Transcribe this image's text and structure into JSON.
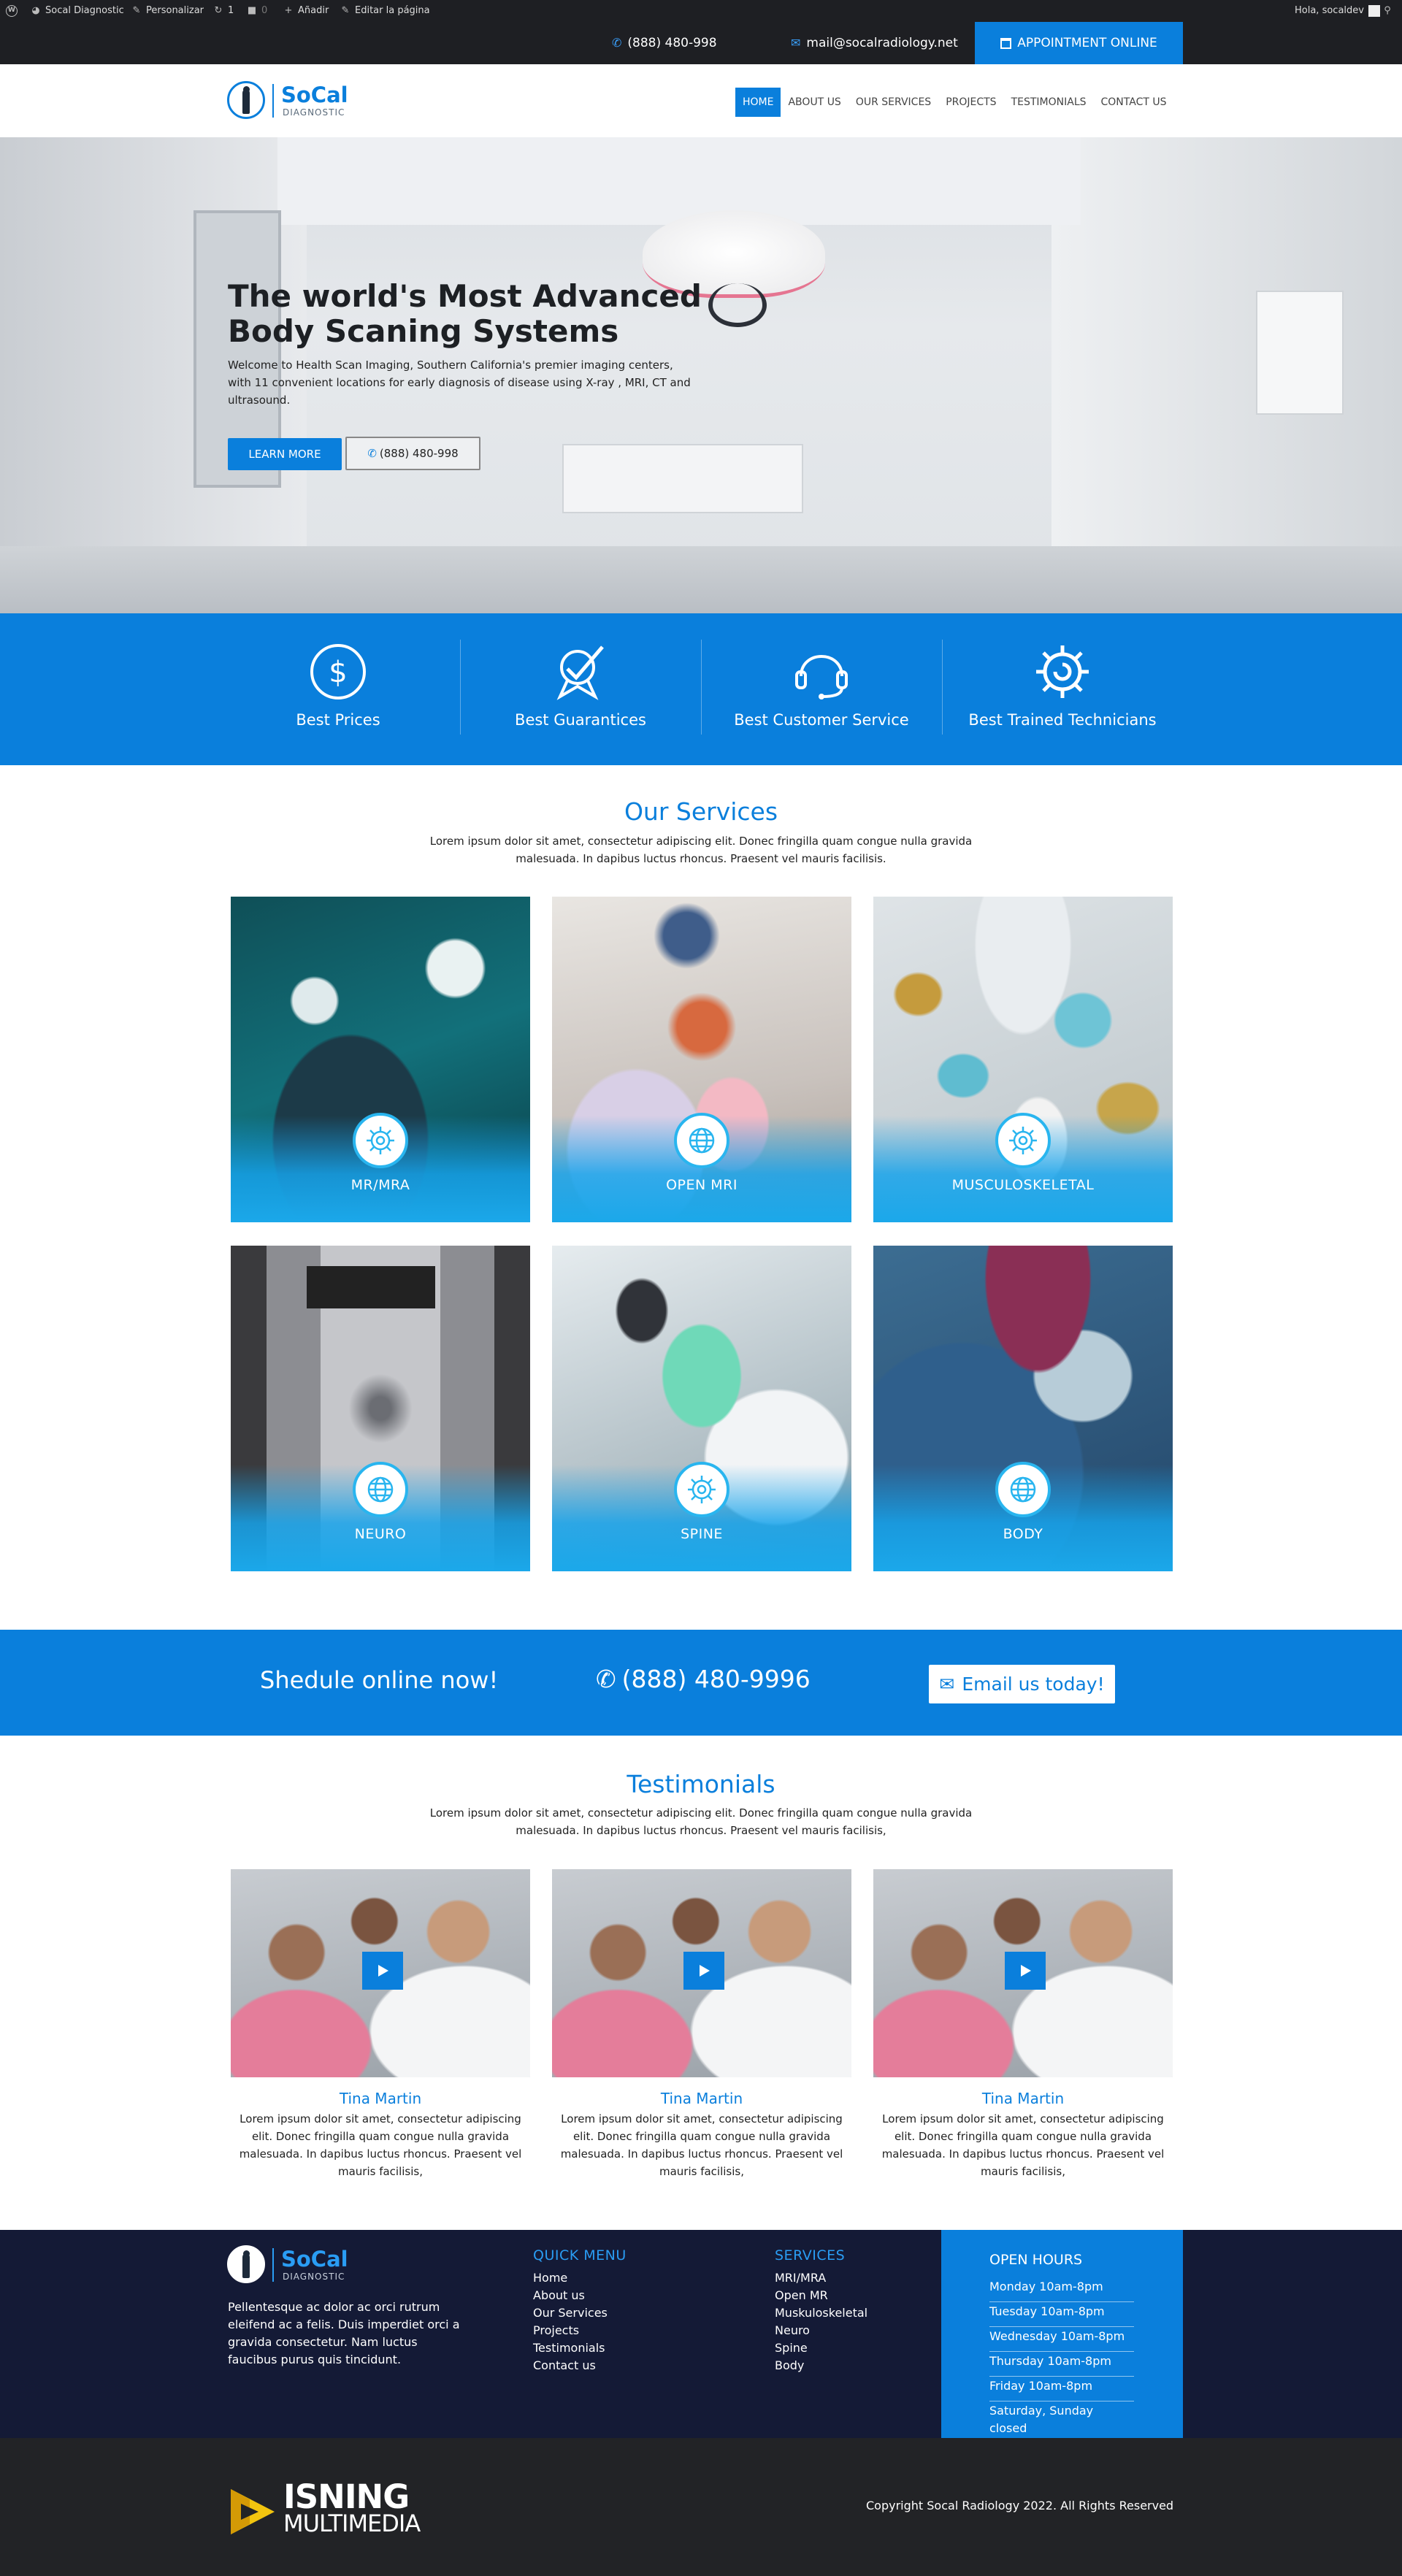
{
  "admin_bar": {
    "site_name": "Socal Diagnostic",
    "customize": "Personalizar",
    "updates": "1",
    "comments": "0",
    "add_new": "Añadir",
    "edit_page": "Editar la página",
    "greeting": "Hola, socaldev"
  },
  "topbar": {
    "phone": "(888) 480-998",
    "email": "mail@socalradiology.net",
    "appointment": "APPOINTMENT ONLINE"
  },
  "logo": {
    "word": "SoCal",
    "sub": "DIAGNOSTIC"
  },
  "nav": [
    {
      "label": "HOME"
    },
    {
      "label": "ABOUT US"
    },
    {
      "label": "OUR SERVICES"
    },
    {
      "label": "PROJECTS"
    },
    {
      "label": "TESTIMONIALS"
    },
    {
      "label": "CONTACT US"
    }
  ],
  "hero": {
    "title": "The world's Most Advanced Body Scaning Systems",
    "text": "Welcome to Health Scan Imaging, Southern California's premier imaging centers, with 11 convenient locations for early diagnosis of disease using X-ray , MRI, CT and ultrasound.",
    "learn_more": "LEARN MORE",
    "phone_button": "(888) 480-998"
  },
  "features": [
    {
      "label": "Best Prices",
      "icon": "dollar-icon"
    },
    {
      "label": "Best Guarantices",
      "icon": "ribbon-check-icon"
    },
    {
      "label": "Best Customer Service",
      "icon": "headset-icon"
    },
    {
      "label": "Best Trained Technicians",
      "icon": "gear-icon"
    }
  ],
  "services": {
    "title": "Our Services",
    "subtitle": "Lorem ipsum dolor sit amet, consectetur adipiscing elit. Donec fringilla quam congue nulla gravida malesuada. In dapibus luctus rhoncus. Praesent vel mauris facilisis.",
    "items": [
      {
        "label": "MR/MRA",
        "icon": "gear-icon"
      },
      {
        "label": "OPEN MRI",
        "icon": "globe-icon"
      },
      {
        "label": "MUSCULOSKELETAL",
        "icon": "gear-icon"
      },
      {
        "label": "NEURO",
        "icon": "globe-icon"
      },
      {
        "label": "SPINE",
        "icon": "gear-icon"
      },
      {
        "label": "BODY",
        "icon": "globe-icon"
      }
    ]
  },
  "schedule": {
    "text": "Shedule online now!",
    "phone": "(888) 480-9996",
    "email_button": "Email us today!"
  },
  "testimonials": {
    "title": "Testimonials",
    "subtitle": "Lorem ipsum dolor sit amet, consectetur adipiscing elit. Donec fringilla quam congue nulla gravida malesuada. In dapibus luctus rhoncus. Praesent vel mauris facilisis,",
    "items": [
      {
        "name": "Tina Martin",
        "text": "Lorem ipsum dolor sit amet, consectetur adipiscing elit. Donec fringilla quam congue nulla gravida malesuada. In dapibus luctus rhoncus. Praesent vel mauris facilisis,"
      },
      {
        "name": "Tina Martin",
        "text": "Lorem ipsum dolor sit amet, consectetur adipiscing elit. Donec fringilla quam congue nulla gravida malesuada. In dapibus luctus rhoncus. Praesent vel mauris facilisis,"
      },
      {
        "name": "Tina Martin",
        "text": "Lorem ipsum dolor sit amet, consectetur adipiscing elit. Donec fringilla quam congue nulla gravida malesuada. In dapibus luctus rhoncus. Praesent vel mauris facilisis,"
      }
    ]
  },
  "footer": {
    "about": "Pellentesque ac dolor ac orci rutrum eleifend ac a felis. Duis imperdiet orci a gravida consectetur. Nam luctus faucibus purus quis tincidunt.",
    "quick_menu_title": "QUICK MENU",
    "quick_menu": [
      "Home",
      "About us",
      "Our Services",
      "Projects",
      "Testimonials",
      "Contact us"
    ],
    "services_title": "SERVICES",
    "services": [
      "MRI/MRA",
      "Open MR",
      "Muskuloskeletal",
      "Neuro",
      "Spine",
      "Body"
    ],
    "hours_title": "OPEN HOURS",
    "hours": [
      "Monday 10am-8pm",
      "Tuesday 10am-8pm",
      "Wednesday 10am-8pm",
      "Thursday 10am-8pm",
      "Friday 10am-8pm",
      "Saturday, Sunday closed"
    ]
  },
  "bottom": {
    "brand_line1": "ISNING",
    "brand_line2": "MULTIMEDIA",
    "copyright": "Copyright Socal Radiology 2022. All Rights Reserved"
  },
  "colors": {
    "brand_blue": "#0a7fdc",
    "dark": "#1e1f23",
    "footer_navy": "#141a36"
  }
}
